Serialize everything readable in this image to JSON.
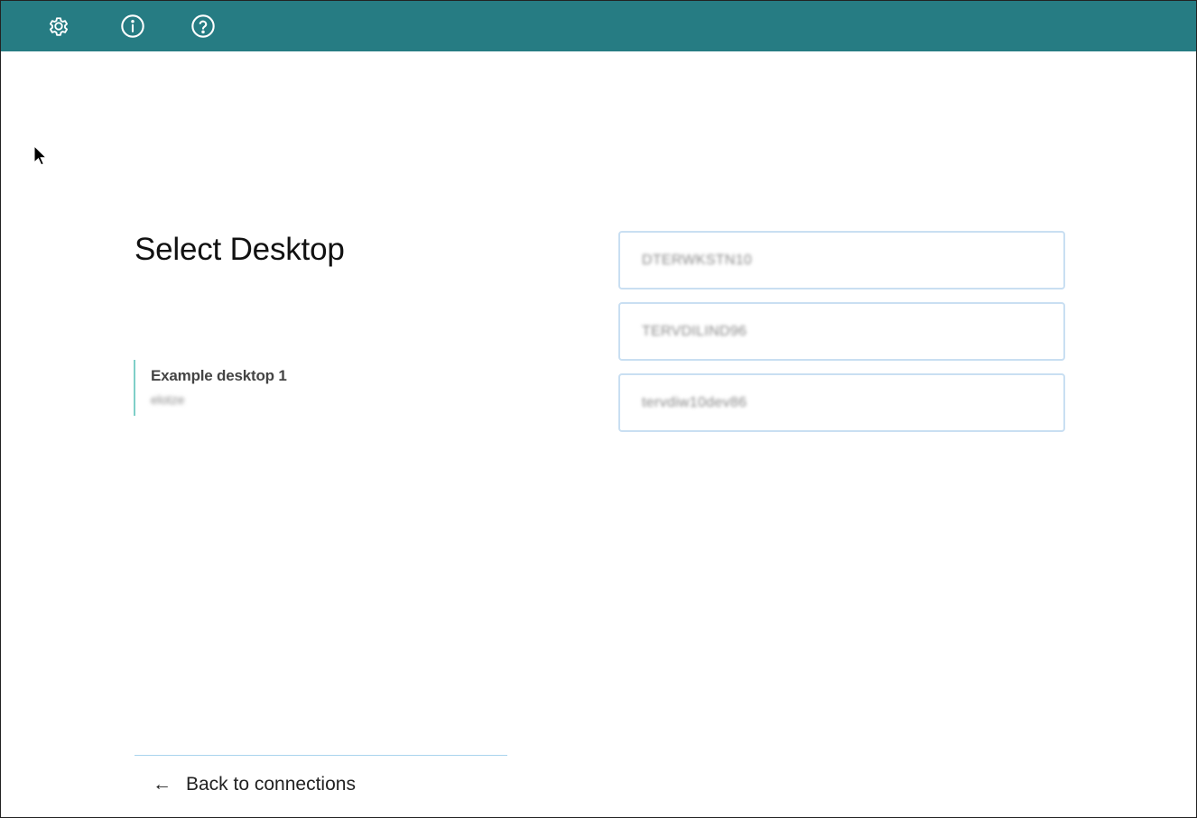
{
  "topbar": {
    "background": "#267c83",
    "icons": [
      {
        "name": "gear-icon"
      },
      {
        "name": "info-icon"
      },
      {
        "name": "help-icon"
      }
    ]
  },
  "main": {
    "title": "Select Desktop",
    "session": {
      "name": "Example desktop 1",
      "user": "elotze"
    },
    "desktops": [
      {
        "label": "DTERWKSTN10"
      },
      {
        "label": "TERVDILIND96"
      },
      {
        "label": "tervdiw10dev86"
      }
    ]
  },
  "footer": {
    "back_arrow": "←",
    "back_label": "Back to connections"
  },
  "colors": {
    "accent": "#267c83",
    "session_border": "#7fcfc8",
    "item_border": "#c9dff2"
  }
}
